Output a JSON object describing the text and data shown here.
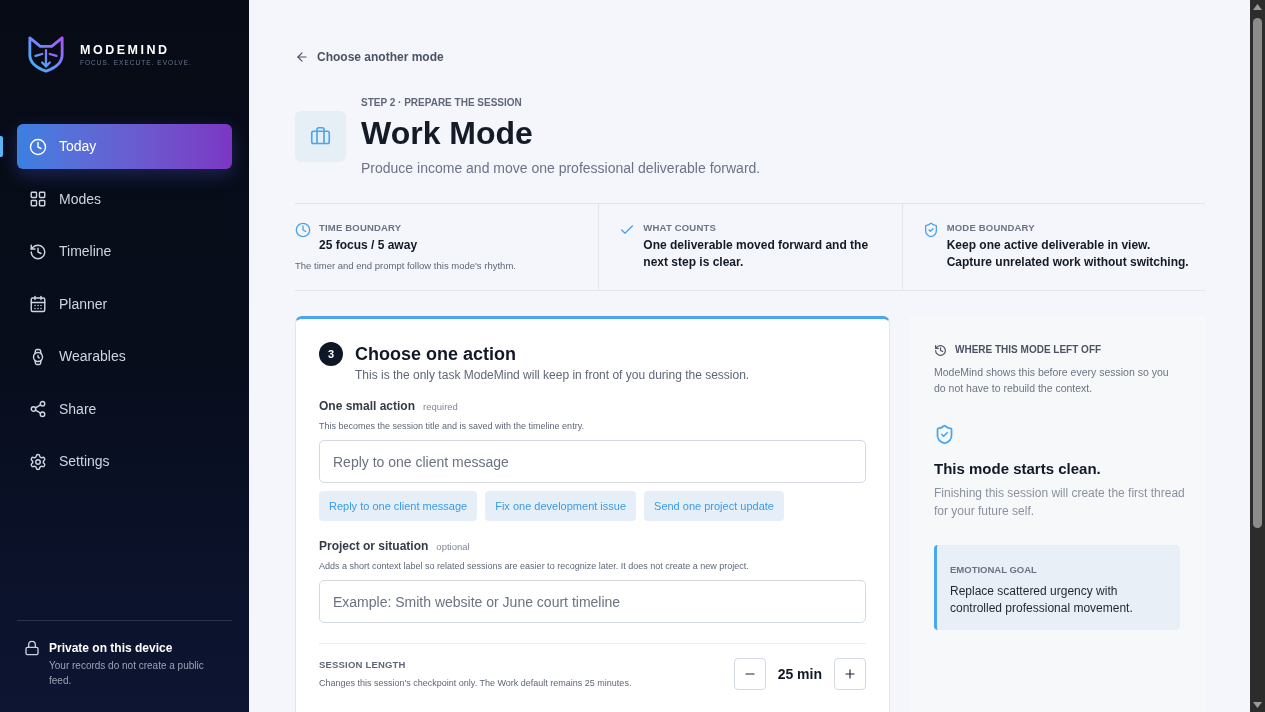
{
  "brand": {
    "name": "MODEMIND",
    "tagline": "FOCUS. EXECUTE. EVOLVE."
  },
  "nav": [
    {
      "label": "Today",
      "selected": true
    },
    {
      "label": "Modes",
      "selected": false
    },
    {
      "label": "Timeline",
      "selected": false
    },
    {
      "label": "Planner",
      "selected": false
    },
    {
      "label": "Wearables",
      "selected": false
    },
    {
      "label": "Share",
      "selected": false
    },
    {
      "label": "Settings",
      "selected": false
    }
  ],
  "privacy": {
    "title": "Private on this device",
    "text": "Your records do not create a public feed."
  },
  "back_link": "Choose another mode",
  "header": {
    "step": "STEP 2 · PREPARE THE SESSION",
    "title": "Work Mode",
    "subtitle": "Produce income and move one professional deliverable forward."
  },
  "boundaries": [
    {
      "label": "TIME BOUNDARY",
      "value": "25 focus / 5 away",
      "note": "The timer and end prompt follow this mode's rhythm."
    },
    {
      "label": "WHAT COUNTS",
      "value": "One deliverable moved forward and the next step is clear."
    },
    {
      "label": "MODE BOUNDARY",
      "value": "Keep one active deliverable in view. Capture unrelated work without switching."
    }
  ],
  "action_card": {
    "step_number": "3",
    "title": "Choose one action",
    "subtitle": "This is the only task ModeMind will keep in front of you during the session.",
    "fields": [
      {
        "label": "One small action",
        "tag": "required",
        "help": "This becomes the session title and is saved with the timeline entry.",
        "placeholder": "Reply to one client message",
        "suggestions": [
          "Reply to one client message",
          "Fix one development issue",
          "Send one project update"
        ]
      },
      {
        "label": "Project or situation",
        "tag": "optional",
        "help": "Adds a short context label so related sessions are easier to recognize later. It does not create a new project.",
        "placeholder": "Example: Smith website or June court timeline"
      }
    ],
    "session_length": {
      "label": "SESSION LENGTH",
      "help": "Changes this session's checkpoint only. The Work default remains 25 minutes.",
      "value": "25 min"
    }
  },
  "side_panel": {
    "title": "WHERE THIS MODE LEFT OFF",
    "text": "ModeMind shows this before every session so you do not have to rebuild the context.",
    "status_title": "This mode starts clean.",
    "status_text": "Finishing this session will create the first thread for your future self.",
    "goal": {
      "label": "EMOTIONAL GOAL",
      "text": "Replace scattered urgency with controlled professional movement."
    }
  }
}
